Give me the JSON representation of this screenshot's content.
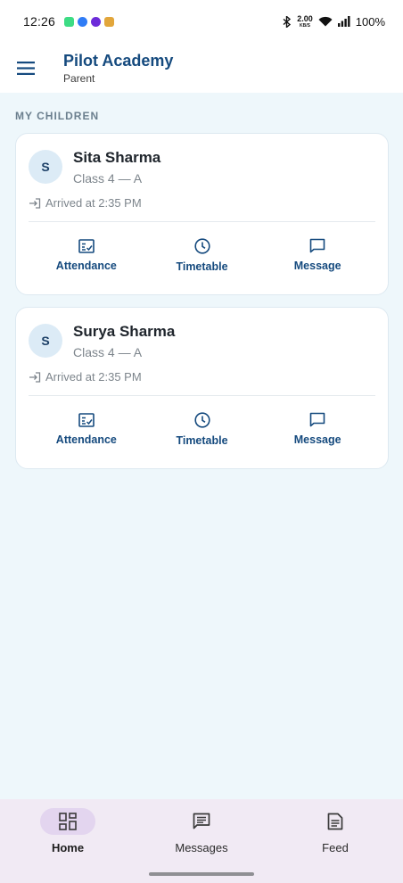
{
  "status_bar": {
    "time": "12:26",
    "speed_value": "2.00",
    "speed_unit": "KB/S",
    "battery": "100%"
  },
  "app_bar": {
    "title": "Pilot Academy",
    "subtitle": "Parent",
    "menu_icon": "menu-icon"
  },
  "section": {
    "title": "MY CHILDREN"
  },
  "children": [
    {
      "initial": "S",
      "name": "Sita Sharma",
      "class": "Class 4 — A",
      "arrival": "Arrived at 2:35 PM",
      "actions": [
        {
          "label": "Attendance",
          "icon": "attendance-icon"
        },
        {
          "label": "Timetable",
          "icon": "clock-icon"
        },
        {
          "label": "Message",
          "icon": "message-icon"
        }
      ]
    },
    {
      "initial": "S",
      "name": "Surya Sharma",
      "class": "Class 4 — A",
      "arrival": "Arrived at 2:35 PM",
      "actions": [
        {
          "label": "Attendance",
          "icon": "attendance-icon"
        },
        {
          "label": "Timetable",
          "icon": "clock-icon"
        },
        {
          "label": "Message",
          "icon": "message-icon"
        }
      ]
    }
  ],
  "bottom_nav": {
    "items": [
      {
        "label": "Home",
        "icon": "dashboard-icon",
        "active": true
      },
      {
        "label": "Messages",
        "icon": "messages-icon",
        "active": false
      },
      {
        "label": "Feed",
        "icon": "feed-icon",
        "active": false
      }
    ]
  },
  "colors": {
    "primary": "#154a7e",
    "background": "#eef7fb",
    "nav_background": "#f1eaf4",
    "nav_active_pill": "#e3d5ef"
  }
}
